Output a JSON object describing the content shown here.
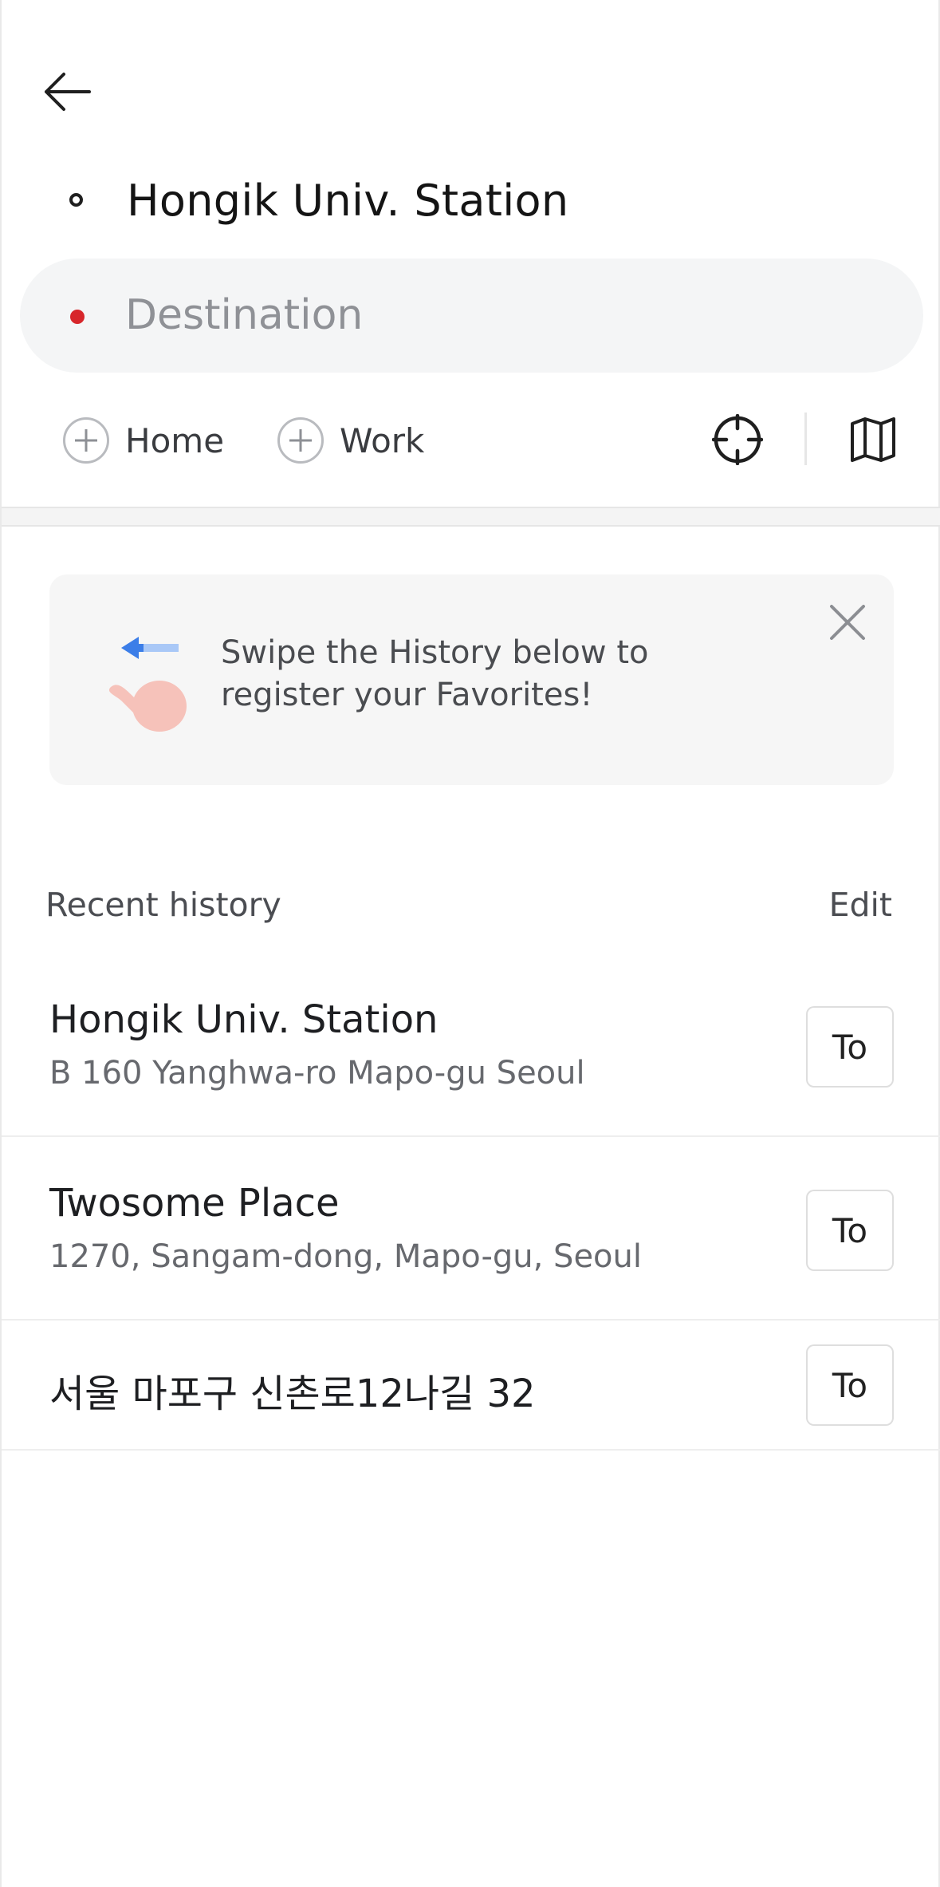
{
  "origin": {
    "text": "Hongik Univ. Station"
  },
  "destination": {
    "placeholder": "Destination"
  },
  "shortcuts": {
    "home_label": "Home",
    "work_label": "Work"
  },
  "tip": {
    "text": "Swipe the History below to\nregister your Favorites!"
  },
  "history": {
    "title": "Recent history",
    "edit_label": "Edit",
    "items": [
      {
        "name": "Hongik Univ. Station",
        "address": "B 160 Yanghwa-ro Mapo-gu Seoul",
        "button": "To"
      },
      {
        "name": "Twosome Place",
        "address": "1270, Sangam-dong, Mapo-gu, Seoul",
        "button": "To"
      },
      {
        "name": "서울 마포구 신촌로12나길 32",
        "address": "",
        "button": "To"
      }
    ]
  },
  "colors": {
    "destination_dot": "#d7262b",
    "field_background": "#f4f5f6",
    "tip_arrow": "#3c7ee8",
    "tip_hand": "#f6c2ba"
  },
  "icons": [
    "back-arrow-icon",
    "origin-dot-icon",
    "destination-dot-icon",
    "plus-icon",
    "crosshair-icon",
    "map-icon",
    "swipe-hand-icon",
    "close-icon"
  ]
}
